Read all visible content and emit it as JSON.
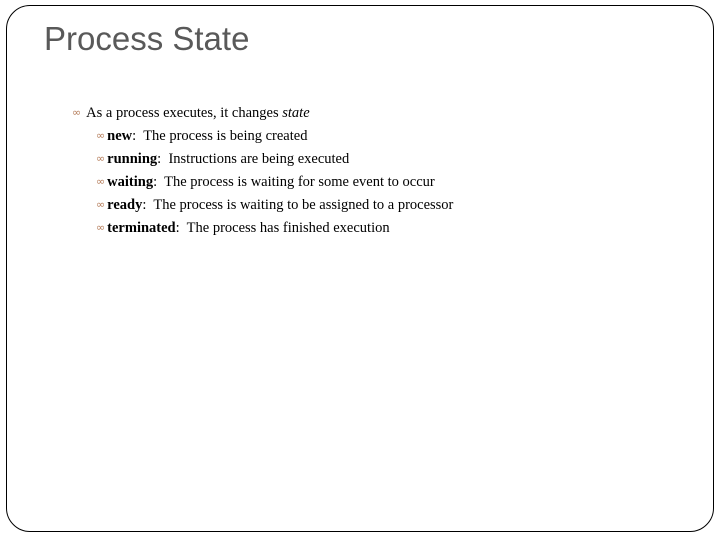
{
  "slide": {
    "title": "Process State",
    "bullet_icon": "wingdings-loop-bullet",
    "bullet_color": "#b7805f",
    "intro": {
      "text": "As a process executes, it changes ",
      "emphasis": "state"
    },
    "states": [
      {
        "term": "new",
        "separator": ":  ",
        "description": "The process is being created"
      },
      {
        "term": "running",
        "separator": ":  ",
        "description": "Instructions are being executed"
      },
      {
        "term": "waiting",
        "separator": ":  ",
        "description": "The process is waiting for some event to occur"
      },
      {
        "term": "ready",
        "separator": ":  ",
        "description": "The process is waiting to be assigned to a processor"
      },
      {
        "term": "terminated",
        "separator": ":  ",
        "description": "The process has finished execution"
      }
    ]
  },
  "glyphs": {
    "bullet": "∞"
  }
}
